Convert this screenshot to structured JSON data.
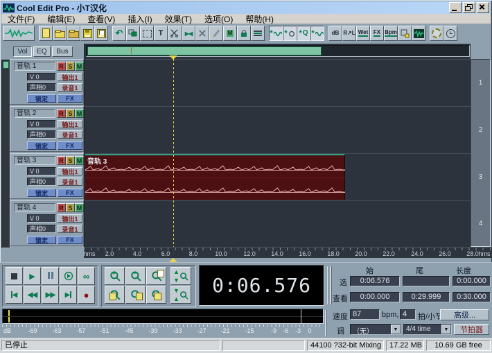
{
  "window": {
    "title": "Cool Edit Pro - 小T汉化"
  },
  "menu": {
    "items": [
      "文件(F)",
      "编辑(E)",
      "查看(V)",
      "插入(I)",
      "效果(T)",
      "选项(O)",
      "帮助(H)"
    ]
  },
  "toolbar": {
    "mute": "M",
    "q": "Q",
    "db": "dB",
    "r": "R",
    "l": "L",
    "wet": "Wet",
    "fx": "FX",
    "bpm": "Bpm"
  },
  "track_panel": {
    "tabs": [
      "Vol",
      "EQ",
      "Bus"
    ],
    "tracks": [
      {
        "name": "音轨  1",
        "r": "R",
        "s": "S",
        "m": "M",
        "vol": "V 0",
        "out": "输出1",
        "pan": "声相0",
        "rec": "录音1",
        "lock": "锁定",
        "fx": "FX"
      },
      {
        "name": "音轨  2",
        "r": "R",
        "s": "S",
        "m": "M",
        "vol": "V 0",
        "out": "输出1",
        "pan": "声相0",
        "rec": "录音1",
        "lock": "锁定",
        "fx": "FX"
      },
      {
        "name": "音轨  3",
        "r": "R",
        "s": "S",
        "m": "M",
        "vol": "V 0",
        "out": "输出1",
        "pan": "声相0",
        "rec": "录音1",
        "lock": "锁定",
        "fx": "FX"
      },
      {
        "name": "音轨  4",
        "r": "R",
        "s": "S",
        "m": "M",
        "vol": "V 0",
        "out": "输出1",
        "pan": "声相0",
        "rec": "录音1",
        "lock": "锁定",
        "fx": "FX"
      }
    ]
  },
  "clip": {
    "label": "音轨 3"
  },
  "gutter": {
    "numbers": [
      "1",
      "2",
      "3",
      "4"
    ]
  },
  "ruler": {
    "ticks": [
      "hms",
      "2.0",
      "4.0",
      "6.0",
      "8.0",
      "10.0",
      "12.0",
      "14.0",
      "16.0",
      "18.0",
      "20.0",
      "22.0",
      "24.0",
      "26.0",
      "28.0",
      "hms"
    ]
  },
  "time_display": {
    "value": "0:06.576"
  },
  "selection": {
    "headers": [
      "始",
      "尾",
      "长度"
    ],
    "row_select": {
      "label": "选",
      "start": "0:06.576",
      "end": "",
      "length": "0:00.000"
    },
    "row_view": {
      "label": "查看",
      "start": "0:00.000",
      "end": "0:29.999",
      "length": "0:30.000"
    }
  },
  "meter": {
    "unit": "dB",
    "ticks": [
      "-69",
      "-63",
      "-57",
      "-51",
      "-45",
      "-39",
      "-33",
      "-27",
      "-21",
      "-15",
      "-9",
      "-6",
      "-3",
      "0"
    ]
  },
  "tempo": {
    "speed_label": "速度",
    "speed": "87",
    "bpm": "bpm,",
    "beats": "4",
    "beats_label": "拍/小节",
    "advanced": "高级...",
    "key_label": "调",
    "key": "（无）",
    "timesig": "4/4 time",
    "metronome": "节拍器"
  },
  "status": {
    "state": "已停止",
    "format": "44100 ?32-bit Mixing",
    "memory": "17.22 MB",
    "disk": "10.69 GB free"
  }
}
